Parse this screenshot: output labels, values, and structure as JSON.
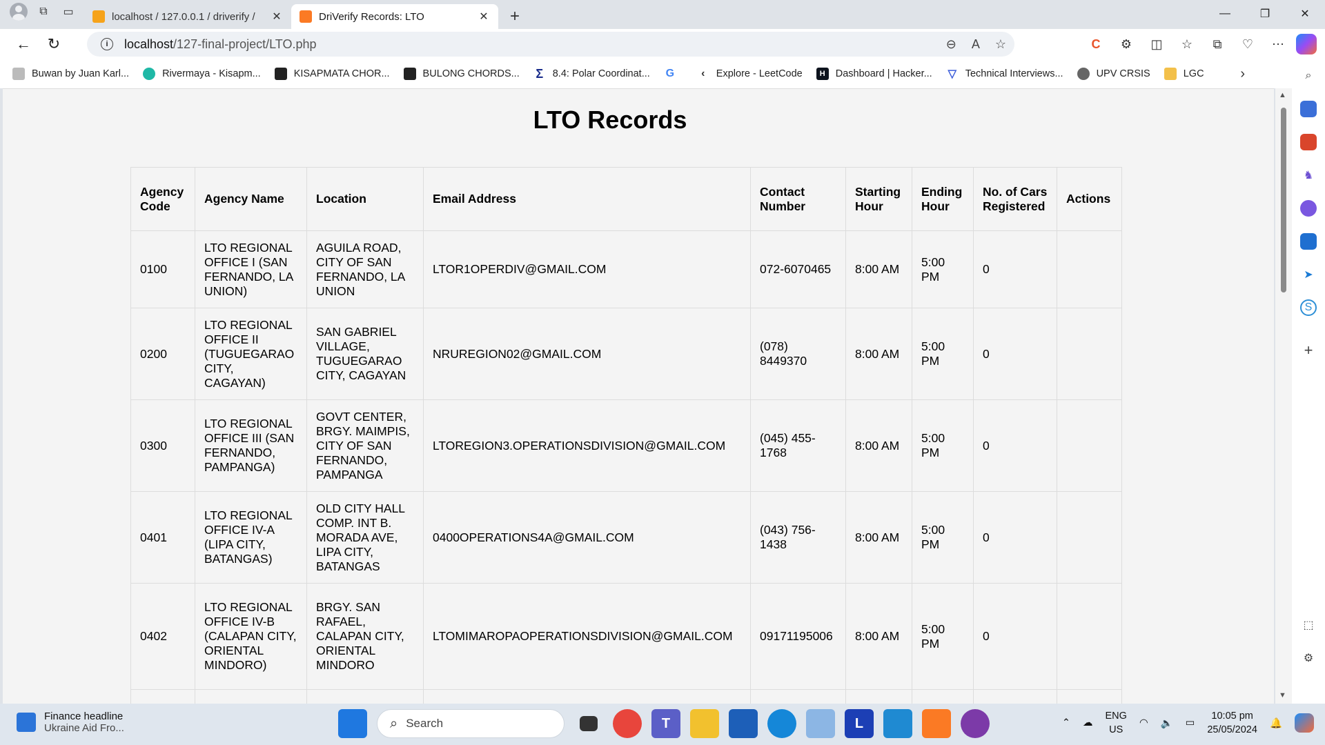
{
  "browser": {
    "tabs": [
      {
        "title": "localhost / 127.0.0.1 / driverify / ",
        "active": false
      },
      {
        "title": "DriVerify Records: LTO",
        "active": true
      }
    ],
    "address": {
      "host": "localhost",
      "path": "/127-final-project/LTO.php"
    },
    "bookmarks": [
      "Buwan by Juan Karl...",
      "Rivermaya - Kisapm...",
      "KISAPMATA CHOR...",
      "BULONG CHORDS...",
      "8.4: Polar Coordinat...",
      "",
      "Explore - LeetCode",
      "Dashboard | Hacker...",
      "Technical Interviews...",
      "UPV CRSIS",
      "LGC"
    ]
  },
  "page": {
    "title": "LTO Records",
    "columns": [
      "Agency Code",
      "Agency Name",
      "Location",
      "Email Address",
      "Contact Number",
      "Starting Hour",
      "Ending Hour",
      "No. of Cars Registered",
      "Actions"
    ],
    "rows": [
      {
        "code": "0100",
        "name": "LTO REGIONAL OFFICE I (SAN FERNANDO, LA UNION)",
        "location": "AGUILA ROAD, CITY OF SAN FERNANDO, LA UNION",
        "email": "LTOR1OPERDIV@GMAIL.COM",
        "contact": "072-6070465",
        "start": "8:00 AM",
        "end": "5:00 PM",
        "cars": "0"
      },
      {
        "code": "0200",
        "name": "LTO REGIONAL OFFICE II (TUGUEGARAO CITY, CAGAYAN)",
        "location": "SAN GABRIEL VILLAGE, TUGUEGARAO CITY, CAGAYAN",
        "email": "NRUREGION02@GMAIL.COM",
        "contact": "(078) 8449370",
        "start": "8:00 AM",
        "end": "5:00 PM",
        "cars": "0"
      },
      {
        "code": "0300",
        "name": "LTO REGIONAL OFFICE III (SAN FERNANDO, PAMPANGA)",
        "location": "GOVT CENTER, BRGY. MAIMPIS, CITY OF SAN FERNANDO, PAMPANGA",
        "email": "LTOREGION3.OPERATIONSDIVISION@GMAIL.COM",
        "contact": "(045) 455-1768",
        "start": "8:00 AM",
        "end": "5:00 PM",
        "cars": "0"
      },
      {
        "code": "0401",
        "name": "LTO REGIONAL OFFICE IV-A (LIPA CITY, BATANGAS)",
        "location": "OLD CITY HALL COMP. INT B. MORADA AVE, LIPA CITY, BATANGAS",
        "email": "0400OPERATIONS4A@GMAIL.COM",
        "contact": "(043) 756-1438",
        "start": "8:00 AM",
        "end": "5:00 PM",
        "cars": "0"
      },
      {
        "code": "0402",
        "name": "LTO REGIONAL OFFICE IV-B (CALAPAN CITY, ORIENTAL MINDORO)",
        "location": "BRGY. SAN RAFAEL, CALAPAN CITY, ORIENTAL MINDORO",
        "email": "LTOMIMAROPAOPERATIONSDIVISION@GMAIL.COM",
        "contact": "09171195006",
        "start": "8:00 AM",
        "end": "5:00 PM",
        "cars": "0"
      }
    ]
  },
  "taskbar": {
    "news_title": "Finance headline",
    "news_sub": "Ukraine Aid Fro...",
    "search_placeholder": "Search",
    "lang_top": "ENG",
    "lang_bottom": "US",
    "time": "10:05 pm",
    "date": "25/05/2024"
  },
  "colors": {
    "accent": "#1d6fd8",
    "table_border": "#dcdcdc",
    "page_bg": "#f4f4f4"
  }
}
